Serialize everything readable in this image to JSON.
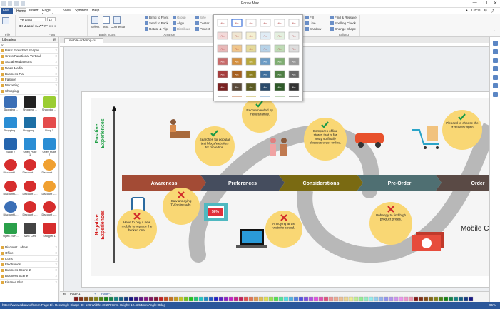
{
  "window": {
    "title": "Edraw Max",
    "controls": [
      "—",
      "❐",
      "✕"
    ]
  },
  "menu": {
    "tabs": [
      "File",
      "Home",
      "Insert",
      "Page Layout",
      "View",
      "Symbols",
      "Help"
    ],
    "active": "Home"
  },
  "user": {
    "name": "Circle"
  },
  "ribbon": {
    "file_group": "File",
    "font_group": "Font",
    "font_name": "Verdana",
    "font_size": "12",
    "basic_tools_group": "Basic Tools",
    "select": "Select",
    "text": "Text",
    "connector": "Connector",
    "arrange_group": "Arrange",
    "bring_front": "Bring to Front",
    "send_back": "Send to Back",
    "rotate_flip": "Rotate & Flip",
    "group": "Group",
    "align": "Align",
    "distribute": "Distribute",
    "size": "Size",
    "center": "Center",
    "protect": "Protect",
    "fill": "Fill",
    "line": "Line",
    "shadow": "Shadow",
    "editing_group": "Editing",
    "find_replace": "Find & Replace",
    "spelling": "Spelling Check",
    "change_shape": "Change Shape",
    "swatch_label": "Abc"
  },
  "libraries": {
    "header": "Libraries",
    "categories_top": [
      "Basic Flowchart Shapes",
      "Cross Functional Vertical",
      "Social Media Icons",
      "News Media",
      "Business Flat",
      "Fashion",
      "Marketing",
      "Shopping"
    ],
    "items": [
      [
        "Shopping ...",
        "Shopping ...",
        "Shopping ..."
      ],
      [
        "Shopping ...",
        "Shopping ...",
        "Shop 1"
      ],
      [
        "Shop 2",
        "Open Plate 1",
        "Open Plate 2"
      ],
      [
        "Discount L...",
        "Discount L...",
        "Discount L..."
      ],
      [
        "Discount L...",
        "Discount L...",
        "Discount L..."
      ],
      [
        "Discount L...",
        "Discount L...",
        "Discount L..."
      ],
      [
        "Open 24 H...",
        "Bank Card",
        "Shopper 1"
      ]
    ],
    "categories_bottom": [
      "Discount Labels",
      "Office",
      "Icons",
      "Electronics",
      "Business Scene 2",
      "Business Scene",
      "Finance Flat"
    ]
  },
  "doc_tab": "mobile-ordering-cu...",
  "diagram": {
    "side_positive": "Positive Experiences",
    "side_negative": "Negative Experiences",
    "stages": [
      "Awareness",
      "Preferences",
      "Considerations",
      "Pre-Order",
      "Order"
    ],
    "stage_colors": [
      "#a34b35",
      "#454d5e",
      "#7a6a12",
      "#4f6f72",
      "#5a4a45"
    ],
    "positive_notes": [
      "Recommended by friends/family.",
      "Searches for popular test blogs/websites for more tips.",
      "Compares offline stores that is far away so finally chooses order online.",
      "Pleased to choose the fr delivery optio"
    ],
    "negative_notes": [
      "Have to buy a new mobile to replace the broken one.",
      "Saw annoying TV/online ads.",
      "Annoying at the website speed.",
      "Unhappy to find high product prices."
    ],
    "right_title": "Mobile C",
    "sale_badge": "50%"
  },
  "page_tabs": {
    "page": "Page-1",
    "current": "Page-1"
  },
  "status": {
    "left": "https://www.edrawsoft.com  Page 1/1  Rectangle  Shape ID: 126  Width: 40.2787mm  Height: 12.4354mm  Angle: 0deg",
    "zoom": "95%"
  },
  "colors": {
    "accent": "#2b579a",
    "note_yellow": "#f9d774",
    "check_green": "#1a9a48",
    "cross_red": "#d12a2a",
    "positive_green": "#1f9f45",
    "negative_red": "#d41f1f"
  }
}
